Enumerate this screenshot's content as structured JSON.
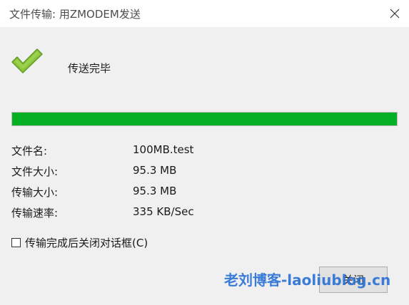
{
  "window": {
    "title": "文件传输: 用ZMODEM发送",
    "close_glyph": "✕"
  },
  "status": {
    "text": "传送完毕",
    "icon": "checkmark-icon",
    "icon_color": "#7fba00"
  },
  "progress": {
    "percent": 100,
    "fill_color": "#06b025"
  },
  "info": {
    "filename_label": "文件名:",
    "filename_value": "100MB.test",
    "filesize_label": "文件大小:",
    "filesize_value": "95.3 MB",
    "transferred_label": "传输大小:",
    "transferred_value": "95.3 MB",
    "rate_label": "传输速率:",
    "rate_value": "335 KB/Sec"
  },
  "options": {
    "auto_close_label": "传输完成后关闭对话框(C)",
    "auto_close_checked": false
  },
  "buttons": {
    "close_label": "关闭"
  },
  "watermark": {
    "text": "老刘博客-laoliublog.cn"
  }
}
